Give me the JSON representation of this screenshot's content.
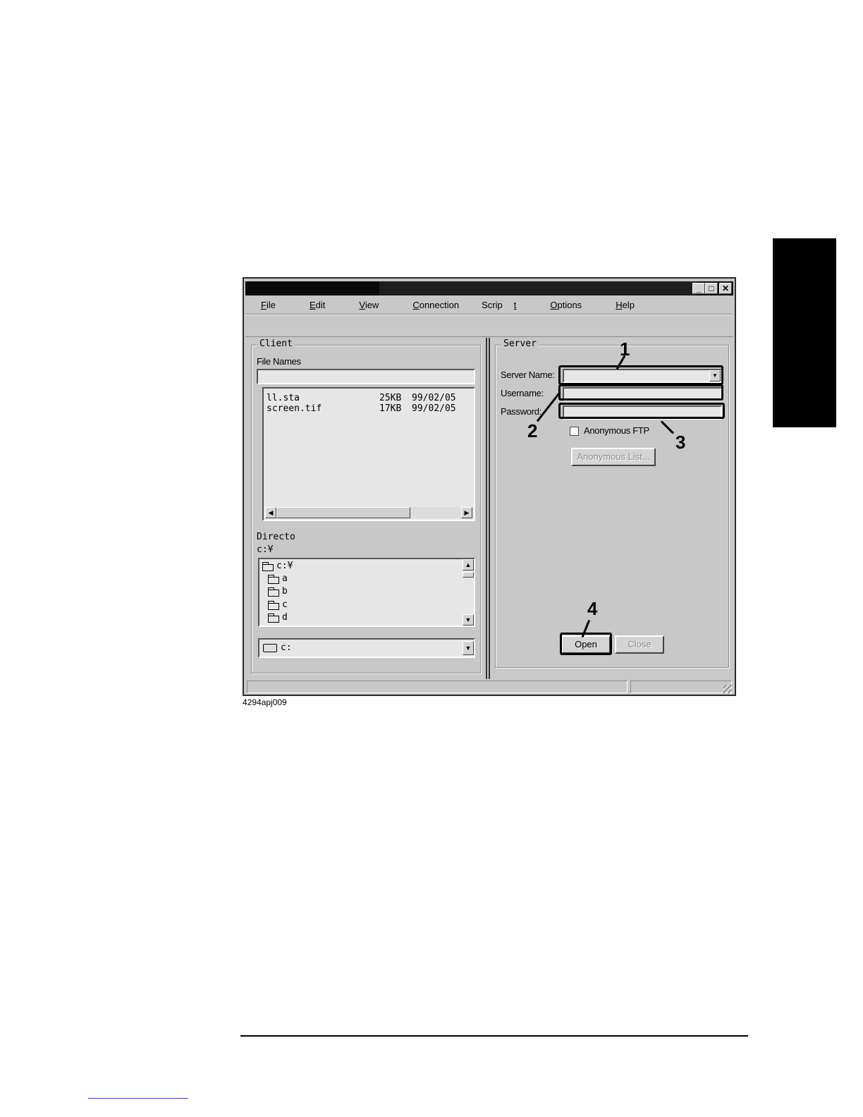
{
  "window": {
    "menu": [
      {
        "pre": "",
        "key": "F",
        "post": "ile"
      },
      {
        "pre": "",
        "key": "E",
        "post": "dit"
      },
      {
        "pre": "",
        "key": "V",
        "post": "iew"
      },
      {
        "pre": "",
        "key": "C",
        "post": "onnection"
      },
      {
        "pre": "Scrip",
        "key": "t",
        "post": ""
      },
      {
        "pre": "",
        "key": "O",
        "post": "ptions"
      },
      {
        "pre": "",
        "key": "H",
        "post": "elp"
      }
    ],
    "controls": {
      "minimize": "_",
      "maximize": "□",
      "close": "✕"
    }
  },
  "client": {
    "group_title": "Client",
    "file_names_label": "File Names",
    "files": [
      {
        "name": "ll.sta",
        "size": "25KB",
        "date": "99/02/05"
      },
      {
        "name": "screen.tif",
        "size": "17KB",
        "date": "99/02/05"
      }
    ],
    "directory_label": "Directo",
    "current_dir": "c:¥",
    "tree": [
      "c:¥",
      "a",
      "b",
      "c",
      "d"
    ],
    "drive": "c:"
  },
  "server": {
    "group_title": "Server",
    "server_name_label": "Server Name:",
    "username_label": "Username:",
    "password_label": "Password:",
    "anonymous_ftp_label": "Anonymous FTP",
    "anonymous_ftp_checked": false,
    "anonymous_list_button": "Anonymous List...",
    "open_button": "Open",
    "close_button": "Close"
  },
  "callouts": [
    "1",
    "2",
    "3",
    "4"
  ],
  "caption": "4294apj009"
}
